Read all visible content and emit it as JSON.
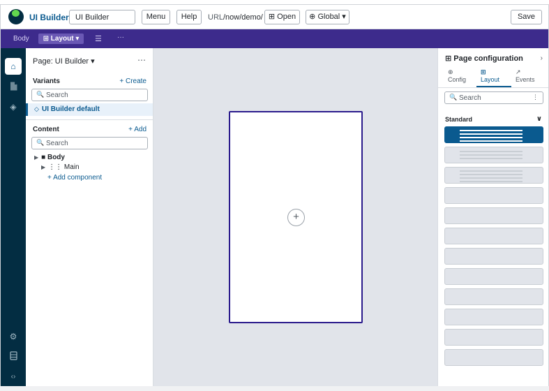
{
  "header": {
    "app_name": "UI Builder",
    "page_name_value": "UI Builder",
    "menu_label": "Menu",
    "help_label": "Help",
    "url_label": "URL",
    "url_value": "/now/demo/",
    "open_label": "⊞ Open",
    "global_label": "⊕ Global ▾",
    "save_label": "Save"
  },
  "toolbar": {
    "body_label": "Body",
    "layout_label": "⊞ Layout ▾",
    "list_icon": "☰",
    "more_icon": "···"
  },
  "rail": {
    "items": [
      {
        "icon": "home-icon",
        "glyph": "⌂"
      },
      {
        "icon": "document-icon",
        "glyph": "📄"
      },
      {
        "icon": "components-icon",
        "glyph": "◈"
      },
      {
        "icon": "gear-icon",
        "glyph": "⚙"
      },
      {
        "icon": "database-icon",
        "glyph": "🗄"
      },
      {
        "icon": "code-icon",
        "glyph": "‹›"
      }
    ]
  },
  "left_panel": {
    "page_title": "Page: UI Builder ▾",
    "more": "⋯",
    "variants": {
      "title": "Variants",
      "create_label": "+ Create",
      "search_placeholder": "Search",
      "selected_glyph": "◇",
      "selected_label": "UI Builder default"
    },
    "content": {
      "title": "Content",
      "add_label": "+ Add",
      "search_placeholder": "Search",
      "tree": {
        "body_label": "■ Body",
        "main_label": "⋮⋮ Main",
        "add_component_label": "+ Add component"
      }
    }
  },
  "canvas": {
    "add_glyph": "+"
  },
  "right_panel": {
    "title": "⊞ Page configuration",
    "collapse_glyph": "›",
    "tabs": [
      {
        "icon": "⊕",
        "label": "Config"
      },
      {
        "icon": "⊞",
        "label": "Layout"
      },
      {
        "icon": "↗",
        "label": "Events"
      }
    ],
    "search_placeholder": "Search",
    "search_menu": "⋮",
    "standard_title": "Standard",
    "standard_chevron": "∨"
  },
  "colors": {
    "brand_blue": "#0a5a8f",
    "toolbar_purple": "#3d2b8c",
    "rail_navy": "#032d42",
    "frame_border": "#2a1a8c"
  }
}
